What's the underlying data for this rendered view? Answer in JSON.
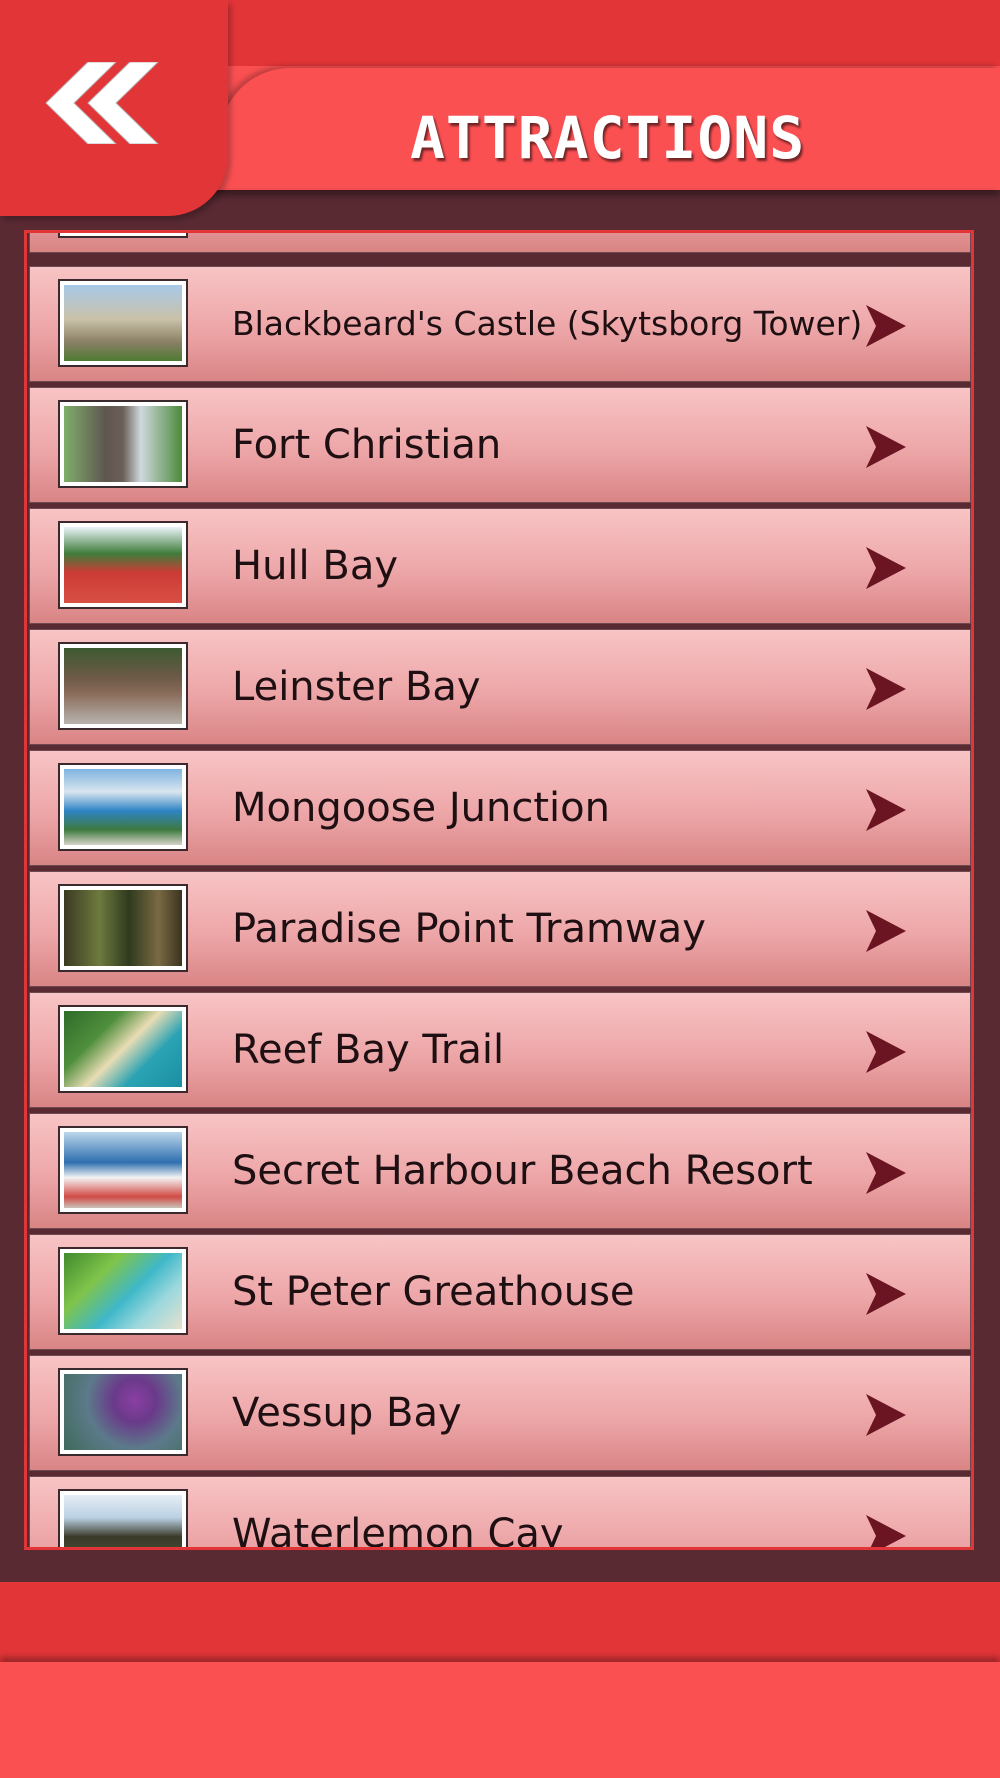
{
  "header": {
    "title": "ATTRACTIONS",
    "back_icon": "double-chevron-left-icon"
  },
  "list": {
    "item_arrow_icon": "play-arrow-right-icon",
    "items": [
      {
        "label": ""
      },
      {
        "label": "Blackbeard's Castle (Skytsborg Tower)"
      },
      {
        "label": "Fort Christian"
      },
      {
        "label": "Hull Bay"
      },
      {
        "label": "Leinster Bay"
      },
      {
        "label": "Mongoose Junction"
      },
      {
        "label": "Paradise Point Tramway"
      },
      {
        "label": "Reef Bay Trail"
      },
      {
        "label": "Secret Harbour Beach Resort"
      },
      {
        "label": "St Peter Greathouse"
      },
      {
        "label": "Vessup Bay"
      },
      {
        "label": "Waterlemon Cay"
      }
    ]
  },
  "colors": {
    "header_dark": "#e23538",
    "header_light": "#fb5052",
    "background": "#5a2a33",
    "arrow": "#6b1523"
  }
}
